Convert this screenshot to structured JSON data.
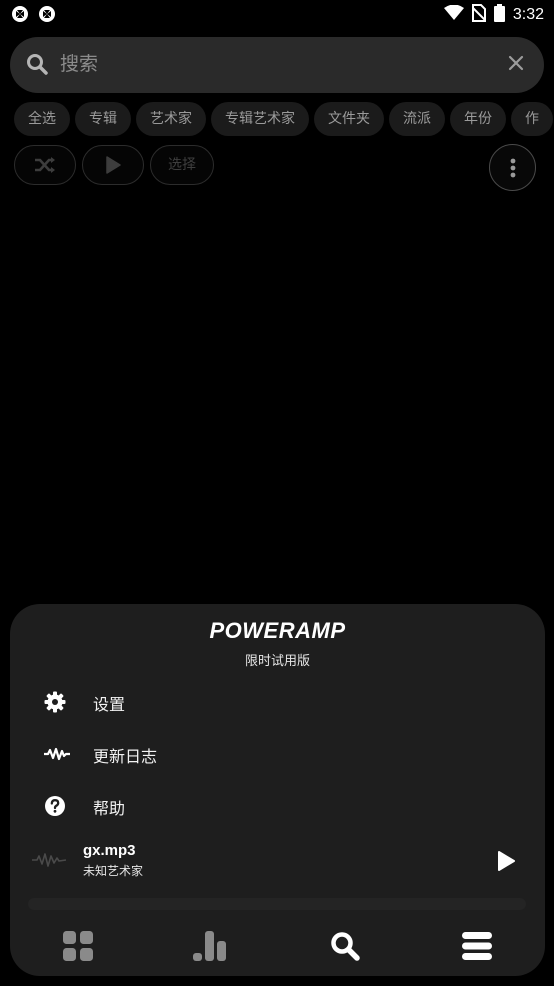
{
  "status_bar": {
    "time": "3:32",
    "left_icons": [
      "sync-icon",
      "sync-icon"
    ],
    "right_icons": [
      "wifi-icon",
      "no-sim-icon",
      "battery-icon"
    ]
  },
  "search": {
    "placeholder": "搜索",
    "value": ""
  },
  "filter_chips": [
    "全选",
    "专辑",
    "艺术家",
    "专辑艺术家",
    "文件夹",
    "流派",
    "年份",
    "作"
  ],
  "actions": {
    "shuffle_icon": "shuffle-icon",
    "play_icon": "play-icon",
    "select_label": "选择",
    "more_icon": "more-vert-icon"
  },
  "sheet": {
    "logo": "POWERAMP",
    "subtitle": "限时试用版",
    "menu": [
      {
        "icon": "gear-icon",
        "label": "设置"
      },
      {
        "icon": "waveform-icon",
        "label": "更新日志"
      },
      {
        "icon": "help-icon",
        "label": "帮助"
      }
    ],
    "now_playing": {
      "title": "gx.mp3",
      "artist": "未知艺术家",
      "progress": 0.0
    },
    "nav": [
      "library-grid-icon",
      "equalizer-icon",
      "search-icon",
      "queue-menu-icon"
    ]
  },
  "colors": {
    "background": "#000000",
    "sheet": "#1e1e1e",
    "chip": "#1b1b1b",
    "search": "#2a2a2a"
  }
}
